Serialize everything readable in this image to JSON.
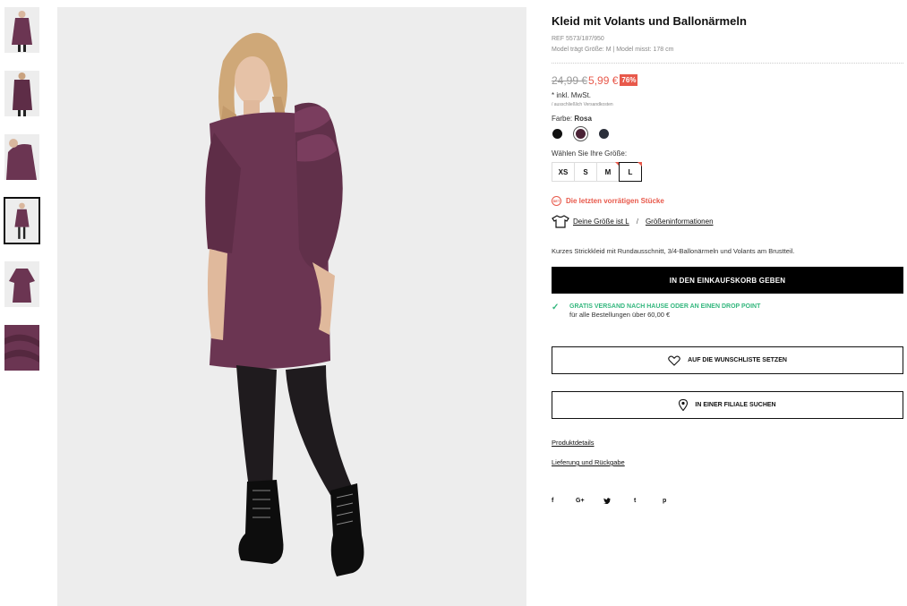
{
  "product": {
    "title": "Kleid mit Volants und Ballonärmeln",
    "ref": "REF 5573/187/950",
    "model_info": "Model trägt Größe: M | Model misst: 178 cm",
    "old_price": "24,99 €",
    "new_price": "5,99 €",
    "discount": "76%",
    "vat": "* inkl. MwSt.",
    "shipping_note": "/ ausschließlich Versandkosten",
    "color_label": "Farbe:",
    "color_value": "Rosa",
    "size_label": "Wählen Sie Ihre Größe:",
    "stock_icon_text": "SET",
    "stock_text": "Die letzten vorrätigen Stücke",
    "your_size": "Deine Größe ist L",
    "size_sep": "/",
    "size_info": "Größeninformationen",
    "description": "Kurzes Strickkleid mit Rundausschnitt, 3/4-Ballonärmeln und Volants am Brustteil.",
    "cart_button": "IN DEN EINKAUFSKORB GEBEN",
    "free_shipping_title": "GRATIS VERSAND NACH HAUSE ODER AN EINEN DROP POINT",
    "free_shipping_sub": "für alle Bestellungen über 60,00 €",
    "wishlist_button": "AUF DIE WUNSCHLISTE SETZEN",
    "store_button": "IN EINER FILIALE SUCHEN",
    "details_link": "Produktdetails",
    "delivery_link": "Lieferung und Rückgabe"
  },
  "sizes": [
    {
      "label": "XS",
      "selected": false,
      "low_stock": false
    },
    {
      "label": "S",
      "selected": false,
      "low_stock": false
    },
    {
      "label": "M",
      "selected": false,
      "low_stock": true
    },
    {
      "label": "L",
      "selected": true,
      "low_stock": true
    }
  ],
  "swatches": [
    {
      "name": "black",
      "color": "#111111",
      "selected": false
    },
    {
      "name": "rosa",
      "color": "#4a2236",
      "selected": true
    },
    {
      "name": "navy",
      "color": "#2b2f3a",
      "selected": false
    }
  ],
  "social": [
    {
      "icon": "facebook-icon",
      "glyph": "f"
    },
    {
      "icon": "google-plus-icon",
      "glyph": "G+"
    },
    {
      "icon": "twitter-icon",
      "glyph": "🐦"
    },
    {
      "icon": "tumblr-icon",
      "glyph": "t"
    },
    {
      "icon": "pinterest-icon",
      "glyph": "p"
    }
  ],
  "colors": {
    "accent_red": "#e8594b",
    "accent_green": "#34b77e",
    "dress": "#6b3552",
    "image_bg": "#ededed"
  }
}
